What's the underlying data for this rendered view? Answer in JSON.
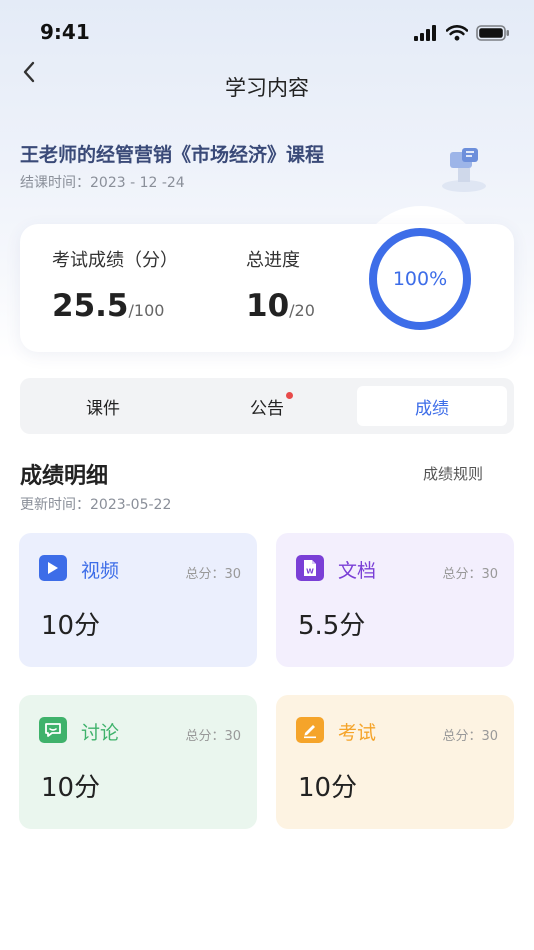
{
  "status_bar": {
    "time": "9:41"
  },
  "nav": {
    "title": "学习内容"
  },
  "course": {
    "title": "王老师的经管营销《市场经济》课程",
    "end_date": "结课时间：2023 - 12 -24"
  },
  "summary": {
    "exam_label": "考试成绩（分）",
    "exam_score": "25.5",
    "exam_total": "/100",
    "progress_label": "总进度",
    "progress_value": "10",
    "progress_total": "/20",
    "progress_percent": "100%",
    "progress_fraction": 1.0,
    "ring_color": "#3d6de8",
    "ring_track_color": "#e9ebf3"
  },
  "tabs": [
    {
      "label": "课件",
      "active": false
    },
    {
      "label": "公告",
      "active": false,
      "has_dot": true
    },
    {
      "label": "成绩",
      "active": true
    }
  ],
  "section": {
    "title": "成绩明细",
    "rules_link": "成绩规则",
    "update_time": "更新时间：2023-05-22"
  },
  "scores": [
    {
      "name": "视频",
      "total": "总分：30",
      "value": "10分",
      "icon": "video-play-icon",
      "accent": "#3d6de8",
      "bg": "#ebeffd"
    },
    {
      "name": "文档",
      "total": "总分：30",
      "value": "5.5分",
      "icon": "word-document-icon",
      "accent": "#7a3fd6",
      "bg": "#f3effd"
    },
    {
      "name": "讨论",
      "total": "总分：30",
      "value": "10分",
      "icon": "chat-bubble-icon",
      "accent": "#3fb26b",
      "bg": "#eaf6ee"
    },
    {
      "name": "考试",
      "total": "总分：30",
      "value": "10分",
      "icon": "pencil-edit-icon",
      "accent": "#f5a42a",
      "bg": "#fdf3e2"
    }
  ]
}
